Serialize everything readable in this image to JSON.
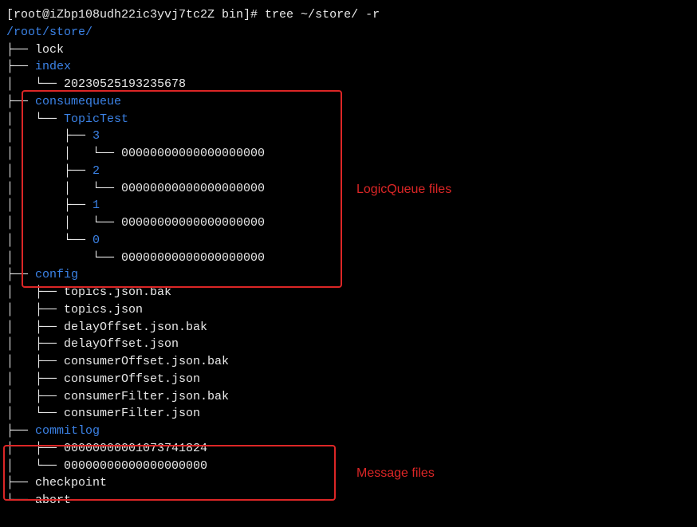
{
  "prompt": "[root@iZbp108udh22ic3yvj7tc2Z bin]# tree ~/store/ -r",
  "root_path": "/root/store/",
  "tree": {
    "l0": "├── ",
    "l0_name": "lock",
    "l1": "├── ",
    "l1_name": "index",
    "l1a": "│   └── ",
    "l1a_name": "20230525193235678",
    "l2": "├── ",
    "l2_name": "consumequeue",
    "l2a": "│   └── ",
    "l2a_name": "TopicTest",
    "l2b": "│       ├── ",
    "l2b_name": "3",
    "l2b1": "│       │   └── ",
    "l2b1_name": "00000000000000000000",
    "l2c": "│       ├── ",
    "l2c_name": "2",
    "l2c1": "│       │   └── ",
    "l2c1_name": "00000000000000000000",
    "l2d": "│       ├── ",
    "l2d_name": "1",
    "l2d1": "│       │   └── ",
    "l2d1_name": "00000000000000000000",
    "l2e": "│       └── ",
    "l2e_name": "0",
    "l2e1": "│           └── ",
    "l2e1_name": "00000000000000000000",
    "l3": "├── ",
    "l3_name": "config",
    "l3a": "│   ├── ",
    "l3a_name": "topics.json.bak",
    "l3b": "│   ├── ",
    "l3b_name": "topics.json",
    "l3c": "│   ├── ",
    "l3c_name": "delayOffset.json.bak",
    "l3d": "│   ├── ",
    "l3d_name": "delayOffset.json",
    "l3e": "│   ├── ",
    "l3e_name": "consumerOffset.json.bak",
    "l3f": "│   ├── ",
    "l3f_name": "consumerOffset.json",
    "l3g": "│   ├── ",
    "l3g_name": "consumerFilter.json.bak",
    "l3h": "│   └── ",
    "l3h_name": "consumerFilter.json",
    "l4": "├── ",
    "l4_name": "commitlog",
    "l4a": "│   ├── ",
    "l4a_name": "00000000001073741824",
    "l4b": "│   └── ",
    "l4b_name": "00000000000000000000",
    "l5": "├── ",
    "l5_name": "checkpoint",
    "l6": "└── ",
    "l6_name": "abort"
  },
  "labels": {
    "logic_queue": "LogicQueue files",
    "message_files": "Message files"
  }
}
